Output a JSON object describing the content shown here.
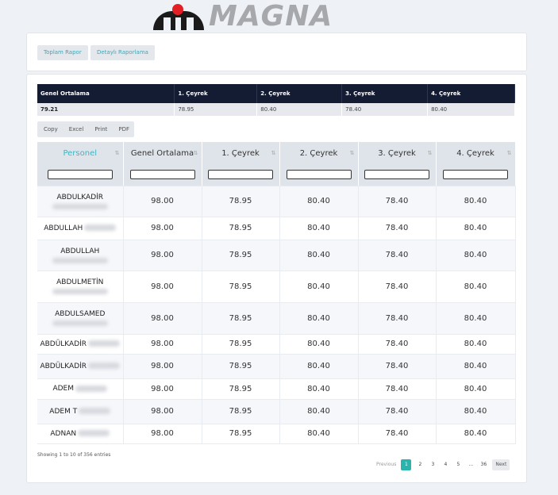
{
  "logo": {
    "text": "MAGNA"
  },
  "report_buttons": [
    "Toplam Rapor",
    "Detaylı Raporlama"
  ],
  "summary": {
    "headers": [
      "Genel Ortalama",
      "1. Çeyrek",
      "2. Çeyrek",
      "3. Çeyrek",
      "4. Çeyrek"
    ],
    "values": [
      "79.21",
      "78.95",
      "80.40",
      "78.40",
      "80.40"
    ]
  },
  "export_buttons": [
    "Copy",
    "Excel",
    "Print",
    "PDF"
  ],
  "table": {
    "columns": [
      "Personel",
      "Genel Ortalama",
      "1. Çeyrek",
      "2. Çeyrek",
      "3. Çeyrek",
      "4. Çeyrek"
    ],
    "rows": [
      {
        "name": "ABDULKADİR",
        "avg": "98.00",
        "q1": "78.95",
        "q2": "80.40",
        "q3": "78.40",
        "q4": "80.40"
      },
      {
        "name": "ABDULLAH",
        "avg": "98.00",
        "q1": "78.95",
        "q2": "80.40",
        "q3": "78.40",
        "q4": "80.40"
      },
      {
        "name": "ABDULLAH",
        "avg": "98.00",
        "q1": "78.95",
        "q2": "80.40",
        "q3": "78.40",
        "q4": "80.40"
      },
      {
        "name": "ABDULMETİN",
        "avg": "98.00",
        "q1": "78.95",
        "q2": "80.40",
        "q3": "78.40",
        "q4": "80.40"
      },
      {
        "name": "ABDULSAMED",
        "avg": "98.00",
        "q1": "78.95",
        "q2": "80.40",
        "q3": "78.40",
        "q4": "80.40"
      },
      {
        "name": "ABDÜLKADİR",
        "avg": "98.00",
        "q1": "78.95",
        "q2": "80.40",
        "q3": "78.40",
        "q4": "80.40"
      },
      {
        "name": "ABDÜLKADİR",
        "avg": "98.00",
        "q1": "78.95",
        "q2": "80.40",
        "q3": "78.40",
        "q4": "80.40"
      },
      {
        "name": "ADEM",
        "avg": "98.00",
        "q1": "78.95",
        "q2": "80.40",
        "q3": "78.40",
        "q4": "80.40"
      },
      {
        "name": "ADEM T",
        "avg": "98.00",
        "q1": "78.95",
        "q2": "80.40",
        "q3": "78.40",
        "q4": "80.40"
      },
      {
        "name": "ADNAN",
        "avg": "98.00",
        "q1": "78.95",
        "q2": "80.40",
        "q3": "78.40",
        "q4": "80.40"
      }
    ]
  },
  "info": "Showing 1 to 10 of 356 entries",
  "pagination": {
    "previous": "Previous",
    "pages": [
      "1",
      "2",
      "3",
      "4",
      "5",
      "...",
      "36"
    ],
    "next": "Next",
    "current": "1"
  },
  "sort_icon": "sort-arrows-icon"
}
